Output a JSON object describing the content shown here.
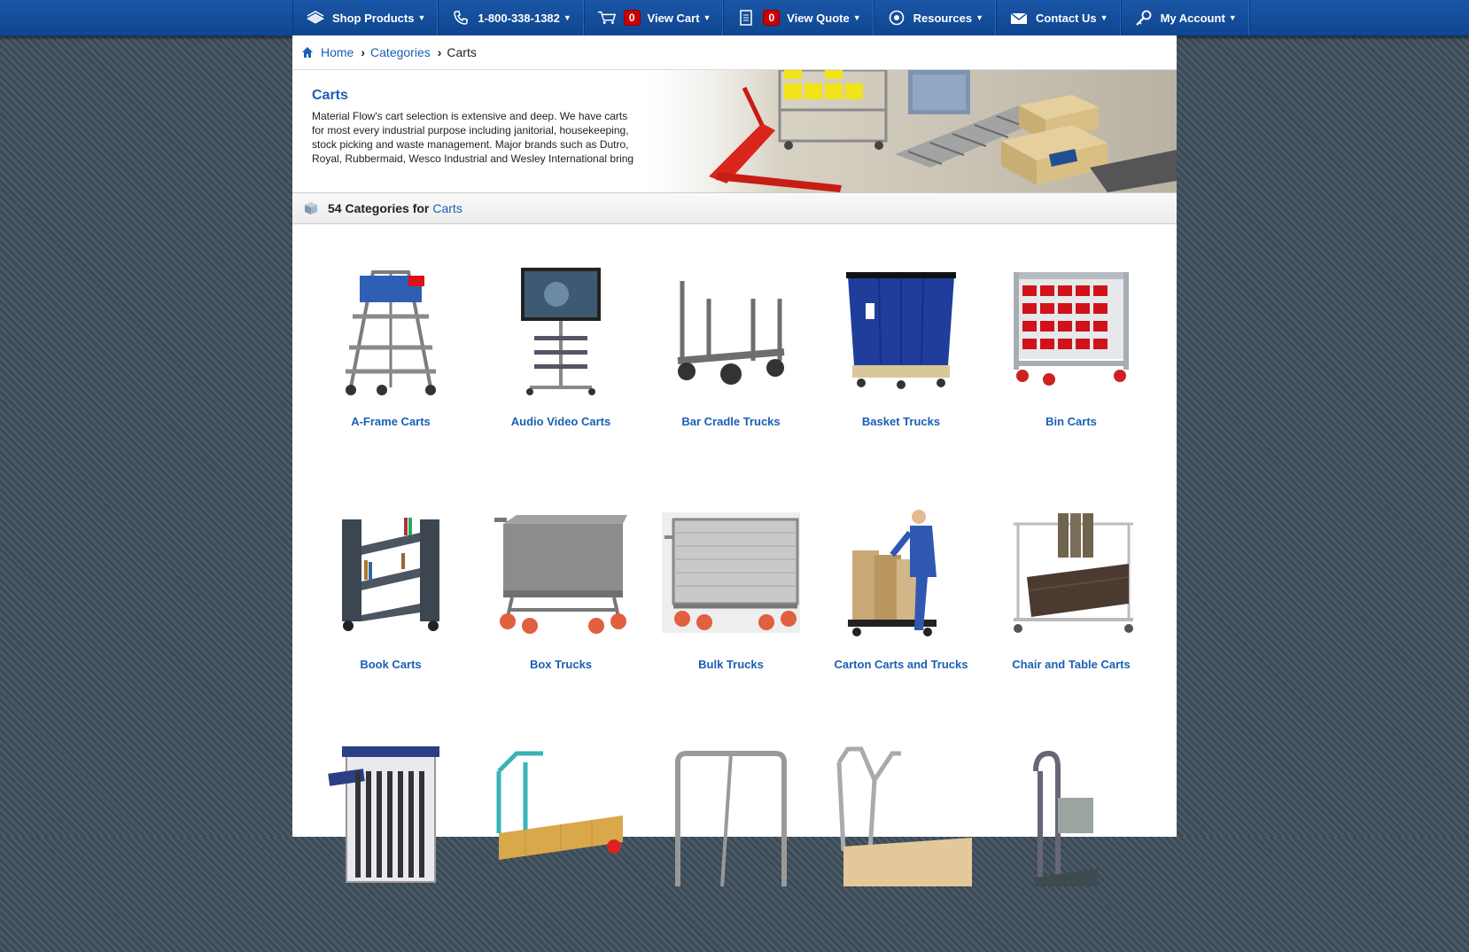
{
  "nav": {
    "shop_products": "Shop Products",
    "phone": "1-800-338-1382",
    "cart_count": "0",
    "view_cart": "View Cart",
    "quote_count": "0",
    "view_quote": "View Quote",
    "resources": "Resources",
    "contact_us": "Contact Us",
    "my_account": "My Account",
    "caret": "▼"
  },
  "breadcrumb": {
    "home": "Home",
    "categories": "Categories",
    "current": "Carts",
    "sep": "›"
  },
  "hero": {
    "title": "Carts",
    "description": "Material Flow's cart selection is extensive and deep. We have carts for most every industrial purpose including janitorial, housekeeping, stock picking and waste management. Major brands such as Dutro, Royal, Rubbermaid, Wesco Industrial and Wesley International bring"
  },
  "category_count": {
    "prefix": "54 Categories for",
    "link": "Carts"
  },
  "categories": [
    {
      "label": "A-Frame Carts",
      "icon": "a-frame-cart-image"
    },
    {
      "label": "Audio Video Carts",
      "icon": "audio-video-cart-image"
    },
    {
      "label": "Bar Cradle Trucks",
      "icon": "bar-cradle-truck-image"
    },
    {
      "label": "Basket Trucks",
      "icon": "basket-truck-image"
    },
    {
      "label": "Bin Carts",
      "icon": "bin-cart-image"
    },
    {
      "label": "Book Carts",
      "icon": "book-cart-image"
    },
    {
      "label": "Box Trucks",
      "icon": "box-truck-image"
    },
    {
      "label": "Bulk Trucks",
      "icon": "bulk-truck-image"
    },
    {
      "label": "Carton Carts and Trucks",
      "icon": "carton-cart-image"
    },
    {
      "label": "Chair and Table Carts",
      "icon": "chair-table-cart-image"
    },
    {
      "label": "",
      "icon": "tray-rack-cart-image"
    },
    {
      "label": "",
      "icon": "platform-truck-image"
    },
    {
      "label": "",
      "icon": "panel-truck-image"
    },
    {
      "label": "",
      "icon": "wood-platform-truck-image"
    },
    {
      "label": "",
      "icon": "hand-truck-image"
    }
  ],
  "colors": {
    "nav_blue": "#1a56a6",
    "link_blue": "#1a5fb4",
    "badge_red": "#cc0000"
  }
}
